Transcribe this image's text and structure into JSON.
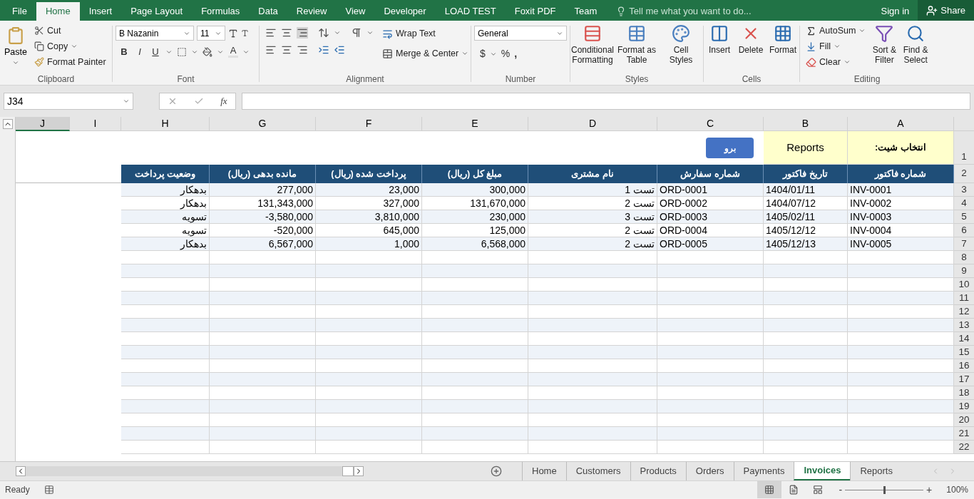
{
  "menu": {
    "tabs": [
      {
        "label": "File",
        "selected": false
      },
      {
        "label": "Home",
        "selected": true
      },
      {
        "label": "Insert",
        "selected": false
      },
      {
        "label": "Page Layout",
        "selected": false
      },
      {
        "label": "Formulas",
        "selected": false
      },
      {
        "label": "Data",
        "selected": false
      },
      {
        "label": "Review",
        "selected": false
      },
      {
        "label": "View",
        "selected": false
      },
      {
        "label": "Developer",
        "selected": false
      },
      {
        "label": "LOAD TEST",
        "selected": false
      },
      {
        "label": "Foxit PDF",
        "selected": false
      },
      {
        "label": "Team",
        "selected": false
      }
    ],
    "tell_me": "Tell me what you want to do...",
    "sign_in": "Sign in",
    "share": "Share"
  },
  "ribbon": {
    "clipboard": {
      "paste": "Paste",
      "cut": "Cut",
      "copy": "Copy",
      "format_painter": "Format Painter",
      "label": "Clipboard"
    },
    "font": {
      "font_name": "B Nazanin",
      "font_size": "11",
      "bold": "B",
      "italic": "I",
      "underline": "U",
      "font_color": "A",
      "label": "Font"
    },
    "alignment": {
      "wrap_text": "Wrap Text",
      "merge_center": "Merge & Center",
      "label": "Alignment"
    },
    "number": {
      "format": "General",
      "currency": "$",
      "percent": "%",
      "comma": ",",
      "label": "Number"
    },
    "styles": {
      "buttons": [
        "Conditional Formatting",
        "Format as Table",
        "Cell Styles"
      ],
      "label": "Styles"
    },
    "cells": {
      "buttons": [
        "Insert",
        "Delete",
        "Format"
      ],
      "label": "Cells"
    },
    "editing": {
      "autosum": "AutoSum",
      "fill": "Fill",
      "clear": "Clear",
      "sort_filter": "Sort & Filter",
      "find_select": "Find & Select",
      "label": "Editing"
    }
  },
  "formula_bar": {
    "name_box": "J34",
    "function_label": "fx"
  },
  "sheet": {
    "columns": [
      {
        "letter": "J",
        "selected": true
      },
      {
        "letter": "I",
        "selected": false
      },
      {
        "letter": "H",
        "selected": false
      },
      {
        "letter": "G",
        "selected": false
      },
      {
        "letter": "F",
        "selected": false
      },
      {
        "letter": "E",
        "selected": false
      },
      {
        "letter": "D",
        "selected": false
      },
      {
        "letter": "C",
        "selected": false
      },
      {
        "letter": "B",
        "selected": false
      },
      {
        "letter": "A",
        "selected": false
      }
    ],
    "top_row": {
      "number": "1",
      "button": "برو",
      "value": "Reports",
      "label": "انتخاب شیت:"
    },
    "header_row": {
      "number": "2",
      "headers": [
        "شماره فاکتور",
        "تاریخ فاکتور",
        "شماره سفارش",
        "نام مشتری",
        "مبلغ کل (ریال)",
        "پرداخت شده (ریال)",
        "مانده بدهی (ریال)",
        "وضعیت پرداخت"
      ]
    },
    "rows": [
      {
        "number": "3",
        "cells": [
          "بدهکار",
          "277,000",
          "23,000",
          "300,000",
          "تست 1",
          "ORD-0001",
          "1404/01/11",
          "INV-0001"
        ]
      },
      {
        "number": "4",
        "cells": [
          "بدهکار",
          "131,343,000",
          "327,000",
          "131,670,000",
          "تست 2",
          "ORD-0002",
          "1404/07/12",
          "INV-0002"
        ]
      },
      {
        "number": "5",
        "cells": [
          "تسویه",
          "-3,580,000",
          "3,810,000",
          "230,000",
          "تست 3",
          "ORD-0003",
          "1405/02/11",
          "INV-0003"
        ]
      },
      {
        "number": "6",
        "cells": [
          "تسویه",
          "-520,000",
          "645,000",
          "125,000",
          "تست 2",
          "ORD-0004",
          "1405/12/12",
          "INV-0004"
        ]
      },
      {
        "number": "7",
        "cells": [
          "بدهکار",
          "6,567,000",
          "1,000",
          "6,568,000",
          "تست 2",
          "ORD-0005",
          "1405/12/13",
          "INV-0005"
        ]
      }
    ],
    "empty_rows": [
      "8",
      "9",
      "10",
      "11",
      "12",
      "13",
      "14",
      "15",
      "16",
      "17",
      "18",
      "19",
      "20",
      "21",
      "22"
    ]
  },
  "sheet_tabs": [
    {
      "label": "Home",
      "selected": false
    },
    {
      "label": "Customers",
      "selected": false
    },
    {
      "label": "Products",
      "selected": false
    },
    {
      "label": "Orders",
      "selected": false
    },
    {
      "label": "Payments",
      "selected": false
    },
    {
      "label": "Invoices",
      "selected": true
    },
    {
      "label": "Reports",
      "selected": false
    }
  ],
  "status_bar": {
    "status": "Ready",
    "zoom_out": "-",
    "zoom_slider": {
      "level": 0.5
    },
    "zoom_in": "+",
    "zoom": "100%"
  }
}
